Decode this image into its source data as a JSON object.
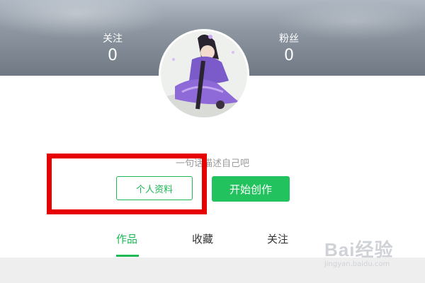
{
  "header": {
    "following_label": "关注",
    "following_count": "0",
    "fans_label": "粉丝",
    "fans_count": "0"
  },
  "profile": {
    "bio_placeholder": "一句话描述自己吧"
  },
  "actions": {
    "profile_button": "个人资料",
    "create_button": "开始创作"
  },
  "tabs": [
    {
      "label": "作品",
      "active": true
    },
    {
      "label": "收藏",
      "active": false
    },
    {
      "label": "关注",
      "active": false
    }
  ],
  "colors": {
    "accent": "#1db954",
    "highlight_box": "#e60000"
  },
  "watermark": {
    "mark": "Bai经验",
    "url": "jingyan.baidu.com"
  }
}
